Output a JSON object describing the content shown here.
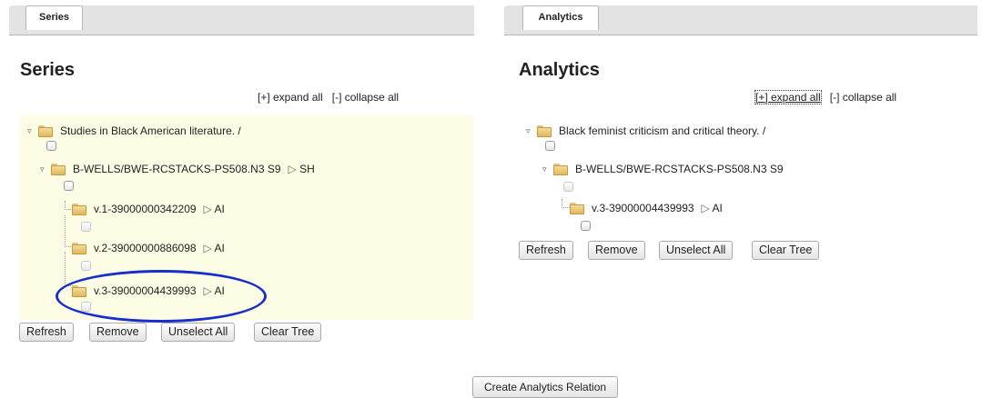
{
  "series_panel": {
    "tab_label": "Series",
    "heading": "Series",
    "expand_all": "[+] expand all",
    "collapse_all": "[-] collapse all",
    "tree": {
      "root": "Studies in Black American literature. /",
      "child": "B-WELLS/BWE-RCSTACKS-PS508.N3 S9",
      "child_tag": "SH",
      "items": [
        {
          "label": "v.1-39000000342209",
          "tag": "AI"
        },
        {
          "label": "v.2-39000000886098",
          "tag": "AI"
        },
        {
          "label": "v.3-39000004439993",
          "tag": "AI"
        }
      ]
    },
    "buttons": {
      "refresh": "Refresh",
      "remove": "Remove",
      "unselect_all": "Unselect All",
      "clear_tree": "Clear Tree"
    }
  },
  "analytics_panel": {
    "tab_label": "Analytics",
    "heading": "Analytics",
    "expand_all": "[+] expand all",
    "collapse_all": "[-] collapse all",
    "tree": {
      "root": "Black feminist criticism and critical theory. /",
      "child": "B-WELLS/BWE-RCSTACKS-PS508.N3 S9",
      "items": [
        {
          "label": "v.3-39000004439993",
          "tag": "AI"
        }
      ]
    },
    "buttons": {
      "refresh": "Refresh",
      "remove": "Remove",
      "unselect_all": "Unselect All",
      "clear_tree": "Clear Tree"
    }
  },
  "create_relation_button": "Create Analytics Relation",
  "highlight_color": "#1a2fc9"
}
